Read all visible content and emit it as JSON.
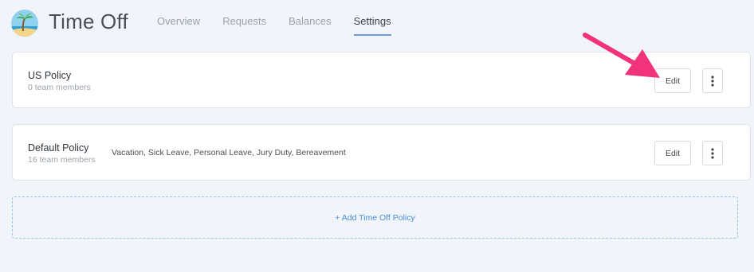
{
  "app": {
    "title": "Time Off",
    "logo_icon": "beach-palm-icon"
  },
  "tabs": [
    {
      "label": "Overview",
      "active": false
    },
    {
      "label": "Requests",
      "active": false
    },
    {
      "label": "Balances",
      "active": false
    },
    {
      "label": "Settings",
      "active": true
    }
  ],
  "policies": [
    {
      "name": "US Policy",
      "members": "0 team members",
      "types": "",
      "edit_label": "Edit",
      "more_icon": "vertical-ellipsis-icon"
    },
    {
      "name": "Default Policy",
      "members": "16 team members",
      "types": "Vacation, Sick Leave, Personal Leave, Jury Duty, Bereavement",
      "edit_label": "Edit",
      "more_icon": "vertical-ellipsis-icon"
    }
  ],
  "add_policy": {
    "label": "+ Add Time Off Policy"
  },
  "colors": {
    "background": "#f1f4f8",
    "accent": "#4a8fd8",
    "tab_underline": "#6b9cd6",
    "annotation_arrow": "#f0337a"
  }
}
